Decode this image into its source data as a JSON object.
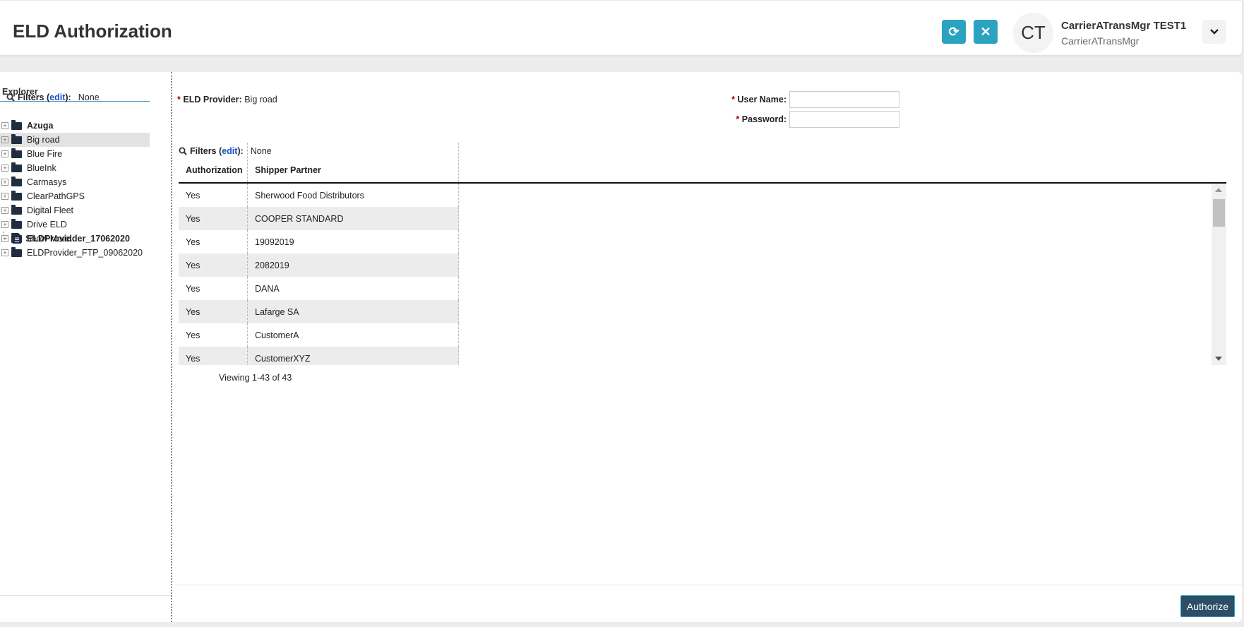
{
  "header": {
    "title": "ELD Authorization",
    "refresh_icon": "refresh-icon",
    "close_icon": "close-icon",
    "avatar_initials": "CT",
    "user_full_name": "CarrierATransMgr TEST1",
    "user_id": "CarrierATransMgr"
  },
  "explorer": {
    "title": "Explorer",
    "filters_label": "Filters (",
    "edit_label": "edit",
    "filters_close": "):",
    "filters_value": "None",
    "items": [
      {
        "label": "Azuga",
        "bold": true
      },
      {
        "label": "Big road",
        "selected": true
      },
      {
        "label": "Blue Fire"
      },
      {
        "label": "BlueInk"
      },
      {
        "label": "Carmasys"
      },
      {
        "label": "ClearPathGPS"
      },
      {
        "label": "Digital Fleet"
      },
      {
        "label": "Drive ELD"
      },
      {
        "label": "ELDProvidder_17062020",
        "bold": true
      },
      {
        "label": "ELDProvider_FTP_09062020"
      }
    ],
    "show_more": "Show More..."
  },
  "form": {
    "required_mark": "*",
    "eld_provider_label": "ELD Provider:",
    "eld_provider_value": "Big road",
    "user_name_label": "User Name:",
    "user_name_value": "",
    "password_label": "Password:",
    "password_value": ""
  },
  "grid": {
    "filters_label": "Filters (",
    "edit_label": "edit",
    "filters_close": "):",
    "filters_value": "None",
    "columns": [
      "Authorization",
      "Shipper Partner"
    ],
    "rows": [
      [
        "Yes",
        "Sherwood Food Distributors"
      ],
      [
        "Yes",
        "COOPER STANDARD"
      ],
      [
        "Yes",
        "19092019"
      ],
      [
        "Yes",
        "2082019"
      ],
      [
        "Yes",
        "DANA"
      ],
      [
        "Yes",
        "Lafarge SA"
      ],
      [
        "Yes",
        "CustomerA"
      ],
      [
        "Yes",
        "CustomerXYZ"
      ]
    ],
    "viewing": "Viewing 1-43 of 43"
  },
  "footer": {
    "authorize_label": "Authorize"
  },
  "colors": {
    "accent": "#2ba3c0",
    "primary_button": "#2c4e66"
  }
}
